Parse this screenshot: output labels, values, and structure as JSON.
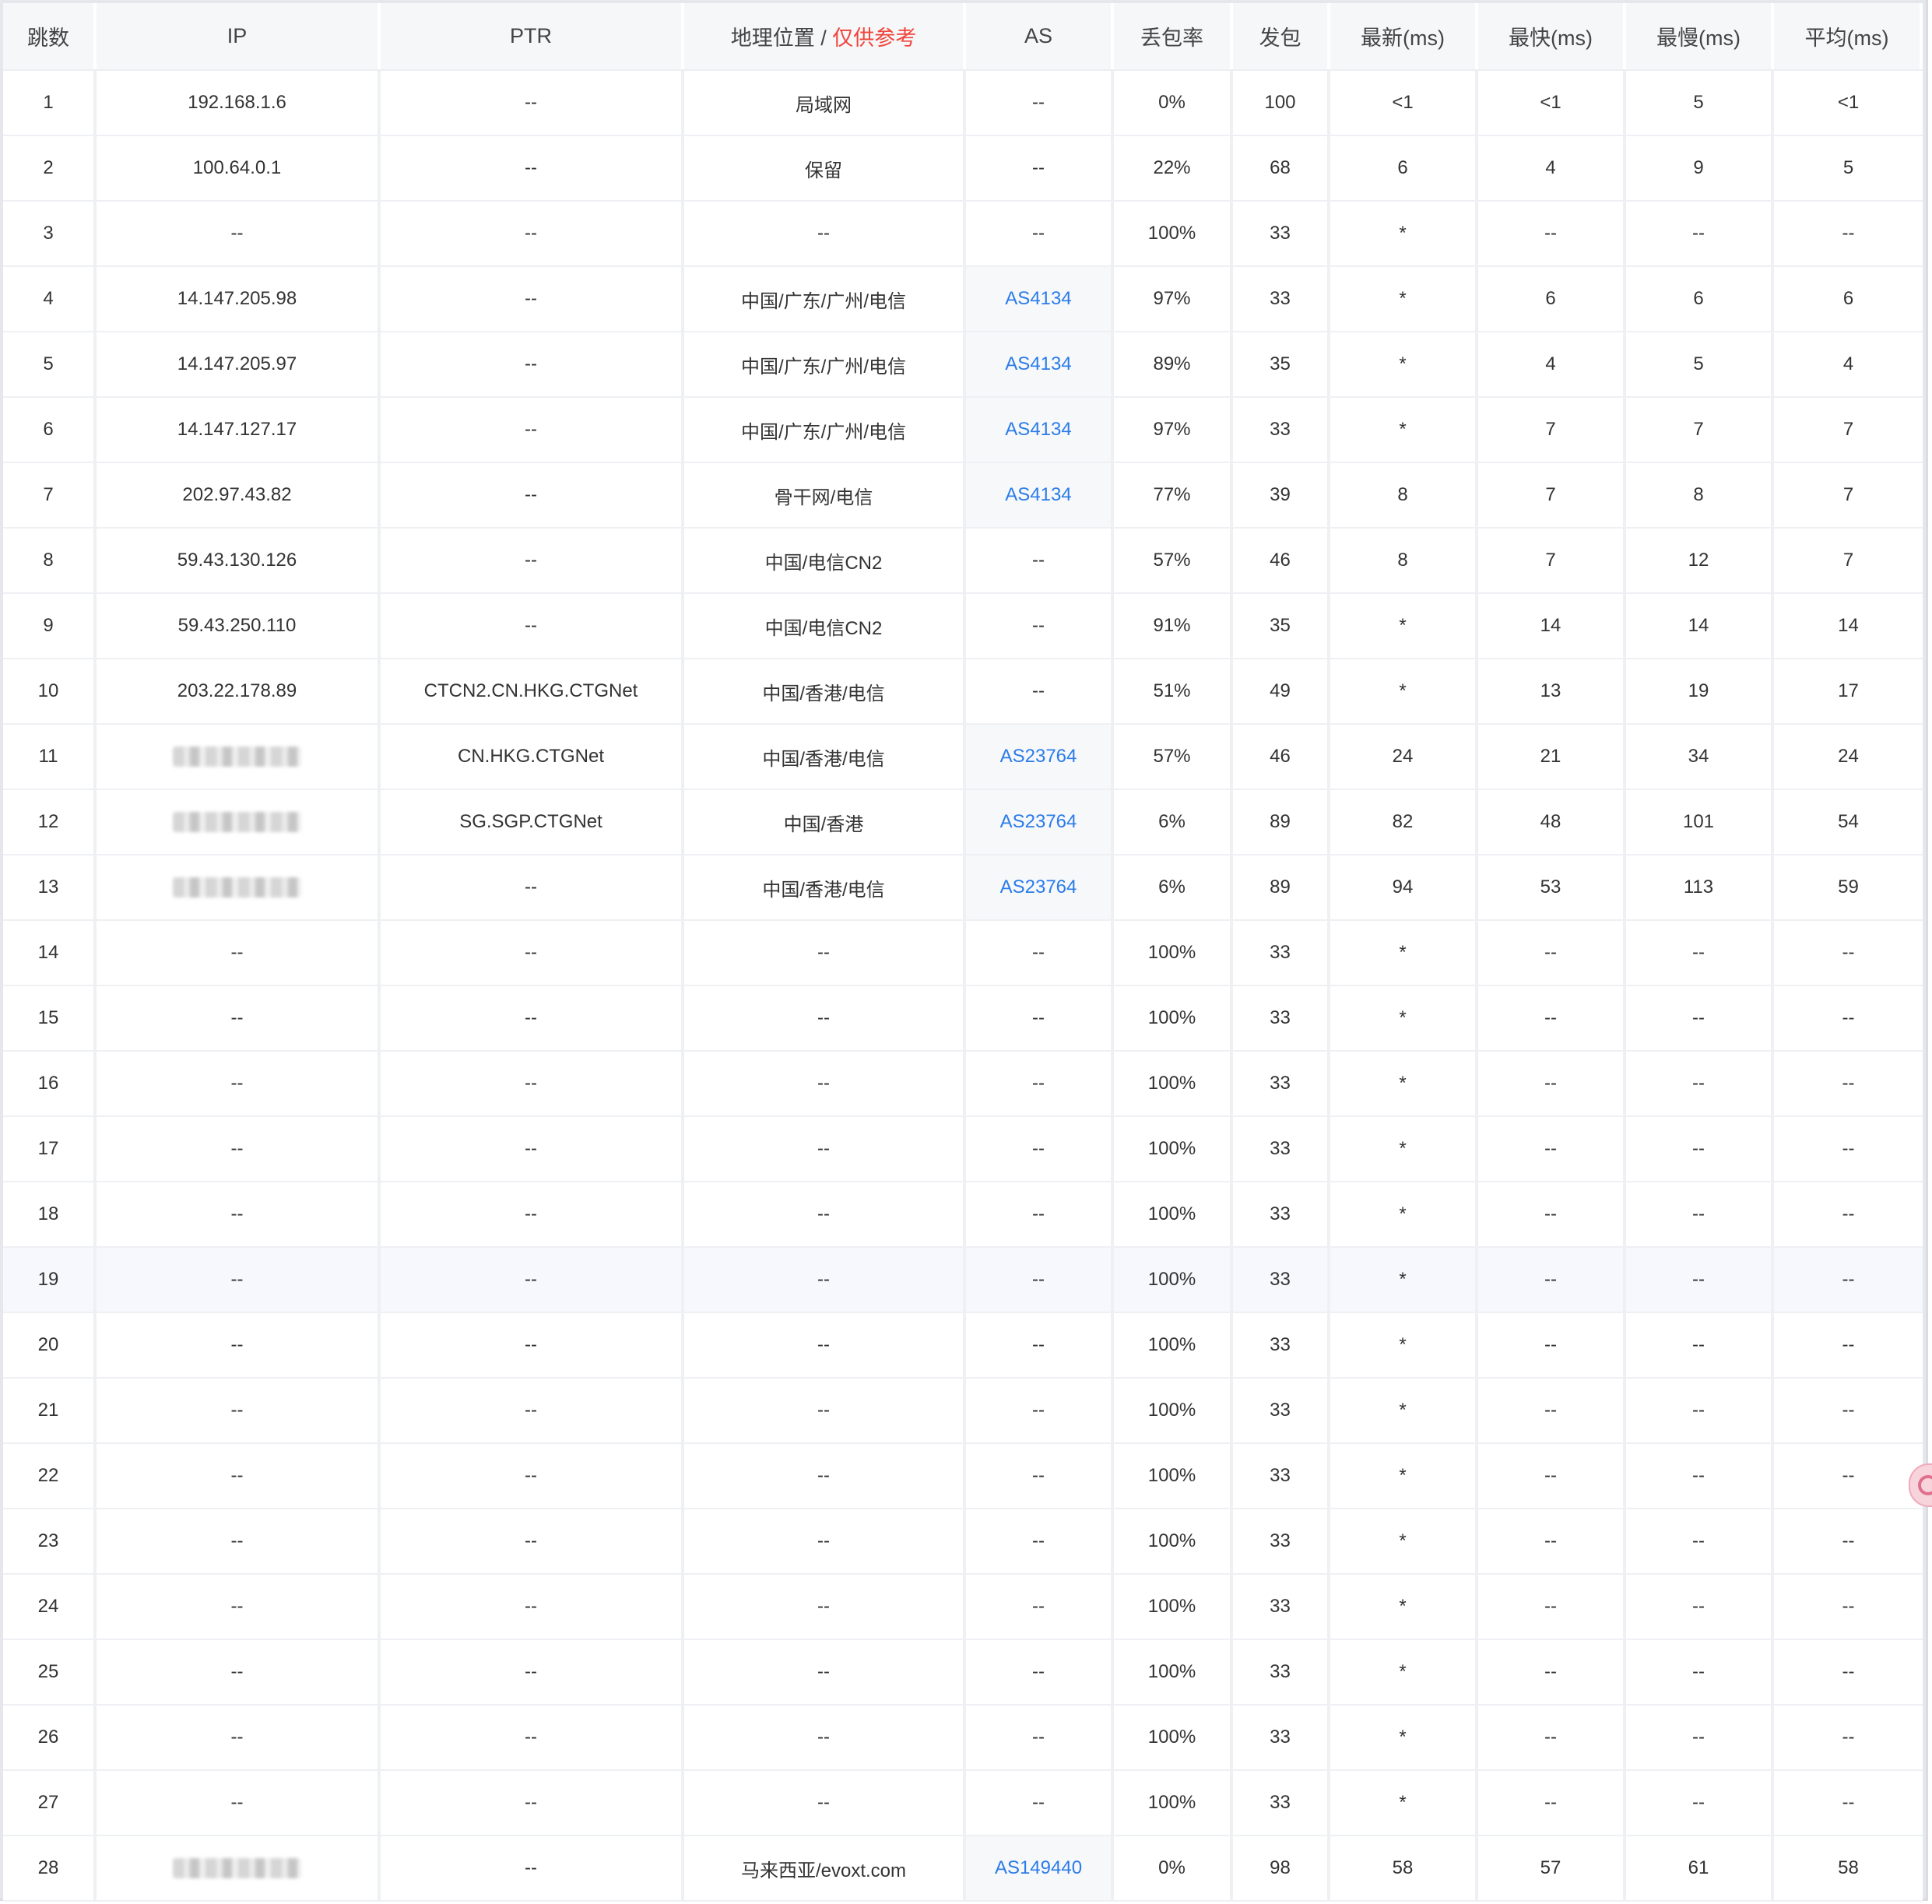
{
  "headers": {
    "hop": "跳数",
    "ip": "IP",
    "ptr": "PTR",
    "geo": "地理位置 / ",
    "geo_note": "仅供参考",
    "as": "AS",
    "loss": "丢包率",
    "sent": "发包",
    "last": "最新(ms)",
    "best": "最快(ms)",
    "worst": "最慢(ms)",
    "avg": "平均(ms)"
  },
  "rows": [
    {
      "hop": "1",
      "ip": "192.168.1.6",
      "ptr": "--",
      "geo": "局域网",
      "as": "--",
      "loss": "0%",
      "sent": "100",
      "last": "<1",
      "best": "<1",
      "worst": "5",
      "avg": "<1"
    },
    {
      "hop": "2",
      "ip": "100.64.0.1",
      "ptr": "--",
      "geo": "保留",
      "as": "--",
      "loss": "22%",
      "sent": "68",
      "last": "6",
      "best": "4",
      "worst": "9",
      "avg": "5"
    },
    {
      "hop": "3",
      "ip": "--",
      "ptr": "--",
      "geo": "--",
      "as": "--",
      "loss": "100%",
      "sent": "33",
      "last": "*",
      "best": "--",
      "worst": "--",
      "avg": "--"
    },
    {
      "hop": "4",
      "ip": "14.147.205.98",
      "ptr": "--",
      "geo": "中国/广东/广州/电信",
      "as": "AS4134",
      "loss": "97%",
      "sent": "33",
      "last": "*",
      "best": "6",
      "worst": "6",
      "avg": "6"
    },
    {
      "hop": "5",
      "ip": "14.147.205.97",
      "ptr": "--",
      "geo": "中国/广东/广州/电信",
      "as": "AS4134",
      "loss": "89%",
      "sent": "35",
      "last": "*",
      "best": "4",
      "worst": "5",
      "avg": "4"
    },
    {
      "hop": "6",
      "ip": "14.147.127.17",
      "ptr": "--",
      "geo": "中国/广东/广州/电信",
      "as": "AS4134",
      "loss": "97%",
      "sent": "33",
      "last": "*",
      "best": "7",
      "worst": "7",
      "avg": "7"
    },
    {
      "hop": "7",
      "ip": "202.97.43.82",
      "ptr": "--",
      "geo": "骨干网/电信",
      "as": "AS4134",
      "loss": "77%",
      "sent": "39",
      "last": "8",
      "best": "7",
      "worst": "8",
      "avg": "7"
    },
    {
      "hop": "8",
      "ip": "59.43.130.126",
      "ptr": "--",
      "geo": "中国/电信CN2",
      "as": "--",
      "loss": "57%",
      "sent": "46",
      "last": "8",
      "best": "7",
      "worst": "12",
      "avg": "7"
    },
    {
      "hop": "9",
      "ip": "59.43.250.110",
      "ptr": "--",
      "geo": "中国/电信CN2",
      "as": "--",
      "loss": "91%",
      "sent": "35",
      "last": "*",
      "best": "14",
      "worst": "14",
      "avg": "14"
    },
    {
      "hop": "10",
      "ip": "203.22.178.89",
      "ptr": "CTCN2.CN.HKG.CTGNet",
      "geo": "中国/香港/电信",
      "as": "--",
      "loss": "51%",
      "sent": "49",
      "last": "*",
      "best": "13",
      "worst": "19",
      "avg": "17"
    },
    {
      "hop": "11",
      "ip": "",
      "ptr": "CN.HKG.CTGNet",
      "geo": "中国/香港/电信",
      "as": "AS23764",
      "loss": "57%",
      "sent": "46",
      "last": "24",
      "best": "21",
      "worst": "34",
      "avg": "24"
    },
    {
      "hop": "12",
      "ip": "",
      "ptr": "SG.SGP.CTGNet",
      "geo": "中国/香港",
      "as": "AS23764",
      "loss": "6%",
      "sent": "89",
      "last": "82",
      "best": "48",
      "worst": "101",
      "avg": "54"
    },
    {
      "hop": "13",
      "ip": "",
      "ptr": "--",
      "geo": "中国/香港/电信",
      "as": "AS23764",
      "loss": "6%",
      "sent": "89",
      "last": "94",
      "best": "53",
      "worst": "113",
      "avg": "59"
    },
    {
      "hop": "14",
      "ip": "--",
      "ptr": "--",
      "geo": "--",
      "as": "--",
      "loss": "100%",
      "sent": "33",
      "last": "*",
      "best": "--",
      "worst": "--",
      "avg": "--"
    },
    {
      "hop": "15",
      "ip": "--",
      "ptr": "--",
      "geo": "--",
      "as": "--",
      "loss": "100%",
      "sent": "33",
      "last": "*",
      "best": "--",
      "worst": "--",
      "avg": "--"
    },
    {
      "hop": "16",
      "ip": "--",
      "ptr": "--",
      "geo": "--",
      "as": "--",
      "loss": "100%",
      "sent": "33",
      "last": "*",
      "best": "--",
      "worst": "--",
      "avg": "--"
    },
    {
      "hop": "17",
      "ip": "--",
      "ptr": "--",
      "geo": "--",
      "as": "--",
      "loss": "100%",
      "sent": "33",
      "last": "*",
      "best": "--",
      "worst": "--",
      "avg": "--"
    },
    {
      "hop": "18",
      "ip": "--",
      "ptr": "--",
      "geo": "--",
      "as": "--",
      "loss": "100%",
      "sent": "33",
      "last": "*",
      "best": "--",
      "worst": "--",
      "avg": "--"
    },
    {
      "hop": "19",
      "ip": "--",
      "ptr": "--",
      "geo": "--",
      "as": "--",
      "loss": "100%",
      "sent": "33",
      "last": "*",
      "best": "--",
      "worst": "--",
      "avg": "--"
    },
    {
      "hop": "20",
      "ip": "--",
      "ptr": "--",
      "geo": "--",
      "as": "--",
      "loss": "100%",
      "sent": "33",
      "last": "*",
      "best": "--",
      "worst": "--",
      "avg": "--"
    },
    {
      "hop": "21",
      "ip": "--",
      "ptr": "--",
      "geo": "--",
      "as": "--",
      "loss": "100%",
      "sent": "33",
      "last": "*",
      "best": "--",
      "worst": "--",
      "avg": "--"
    },
    {
      "hop": "22",
      "ip": "--",
      "ptr": "--",
      "geo": "--",
      "as": "--",
      "loss": "100%",
      "sent": "33",
      "last": "*",
      "best": "--",
      "worst": "--",
      "avg": "--"
    },
    {
      "hop": "23",
      "ip": "--",
      "ptr": "--",
      "geo": "--",
      "as": "--",
      "loss": "100%",
      "sent": "33",
      "last": "*",
      "best": "--",
      "worst": "--",
      "avg": "--"
    },
    {
      "hop": "24",
      "ip": "--",
      "ptr": "--",
      "geo": "--",
      "as": "--",
      "loss": "100%",
      "sent": "33",
      "last": "*",
      "best": "--",
      "worst": "--",
      "avg": "--"
    },
    {
      "hop": "25",
      "ip": "--",
      "ptr": "--",
      "geo": "--",
      "as": "--",
      "loss": "100%",
      "sent": "33",
      "last": "*",
      "best": "--",
      "worst": "--",
      "avg": "--"
    },
    {
      "hop": "26",
      "ip": "--",
      "ptr": "--",
      "geo": "--",
      "as": "--",
      "loss": "100%",
      "sent": "33",
      "last": "*",
      "best": "--",
      "worst": "--",
      "avg": "--"
    },
    {
      "hop": "27",
      "ip": "--",
      "ptr": "--",
      "geo": "--",
      "as": "--",
      "loss": "100%",
      "sent": "33",
      "last": "*",
      "best": "--",
      "worst": "--",
      "avg": "--"
    },
    {
      "hop": "28",
      "ip": "",
      "ptr": "--",
      "geo": "马来西亚/evoxt.com",
      "as": "AS149440",
      "loss": "0%",
      "sent": "98",
      "last": "58",
      "best": "57",
      "worst": "61",
      "avg": "58"
    }
  ],
  "ip_redacted_hops": [
    "11",
    "12",
    "13",
    "28"
  ],
  "highlighted_hop": "19",
  "colors": {
    "as_link": "#2b7ce9",
    "geo_note": "#f0443c"
  },
  "side_button_icon": "refresh-icon"
}
